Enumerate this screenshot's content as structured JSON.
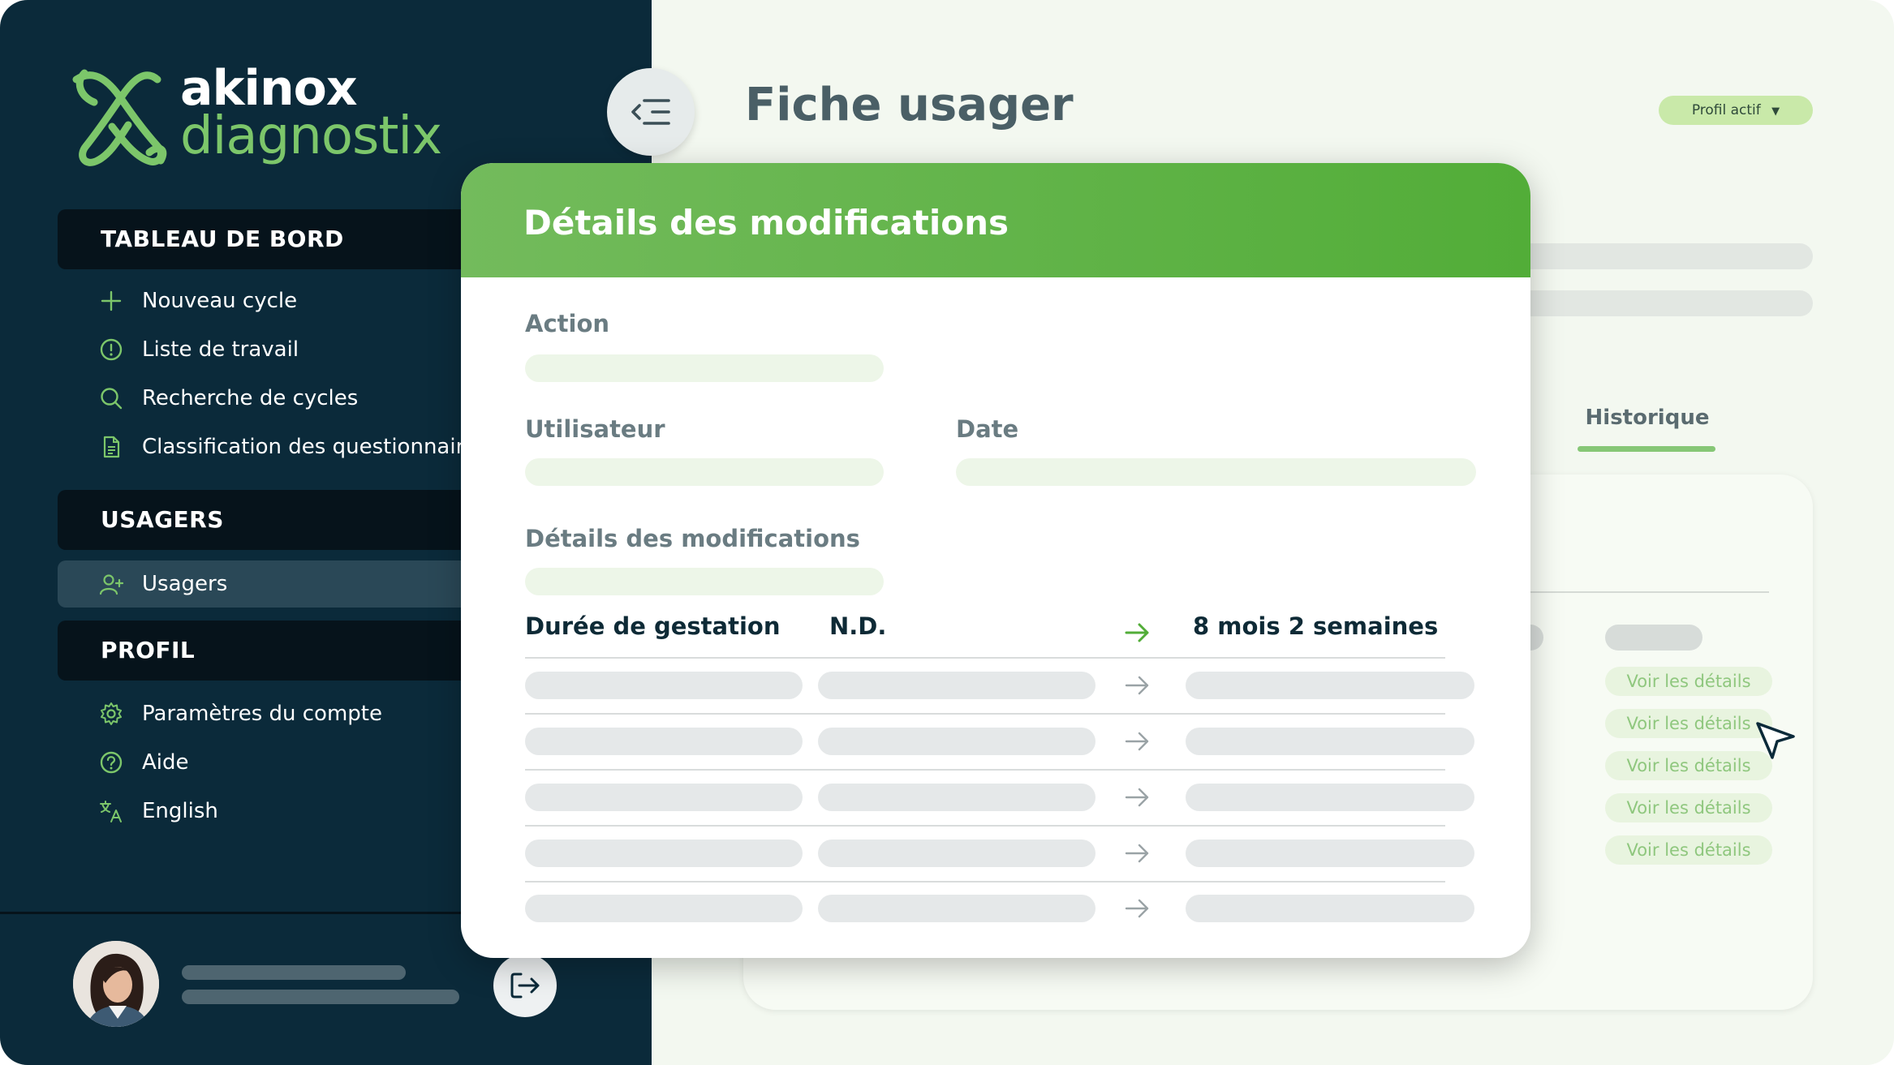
{
  "brand": {
    "line1": "akinox",
    "line2": "diagnostix"
  },
  "sidebar": {
    "sections": [
      {
        "title": "TABLEAU DE BORD"
      },
      {
        "title": "USAGERS"
      },
      {
        "title": "PROFIL"
      }
    ],
    "dashboard_items": [
      {
        "label": "Nouveau cycle",
        "icon": "plus-icon"
      },
      {
        "label": "Liste de travail",
        "icon": "alert-circle-icon"
      },
      {
        "label": "Recherche de cycles",
        "icon": "search-icon"
      },
      {
        "label": "Classification des questionnaires",
        "icon": "document-icon"
      }
    ],
    "usagers_items": [
      {
        "label": "Usagers",
        "icon": "add-user-icon",
        "active": true
      }
    ],
    "profile_items": [
      {
        "label": "Paramètres du compte",
        "icon": "gear-icon"
      },
      {
        "label": "Aide",
        "icon": "help-icon"
      },
      {
        "label": "English",
        "icon": "translate-icon"
      }
    ]
  },
  "header": {
    "title": "Fiche usager",
    "profile_status": "Profil actif"
  },
  "tabs": {
    "history": "Historique"
  },
  "history_links": [
    "Voir les détails",
    "Voir les détails",
    "Voir les détails",
    "Voir les détails",
    "Voir les détails"
  ],
  "modal": {
    "title": "Détails des modifications",
    "fields": {
      "action_label": "Action",
      "user_label": "Utilisateur",
      "date_label": "Date",
      "details_label": "Détails des modifications"
    },
    "change_row": {
      "field": "Durée de gestation",
      "old_value": "N.D.",
      "new_value": "8 mois 2 semaines"
    }
  },
  "colors": {
    "sidebar_bg": "#0b2a3a",
    "section_bg": "#06131b",
    "accent_green": "#52ad38",
    "light_green": "#7cc66a"
  }
}
